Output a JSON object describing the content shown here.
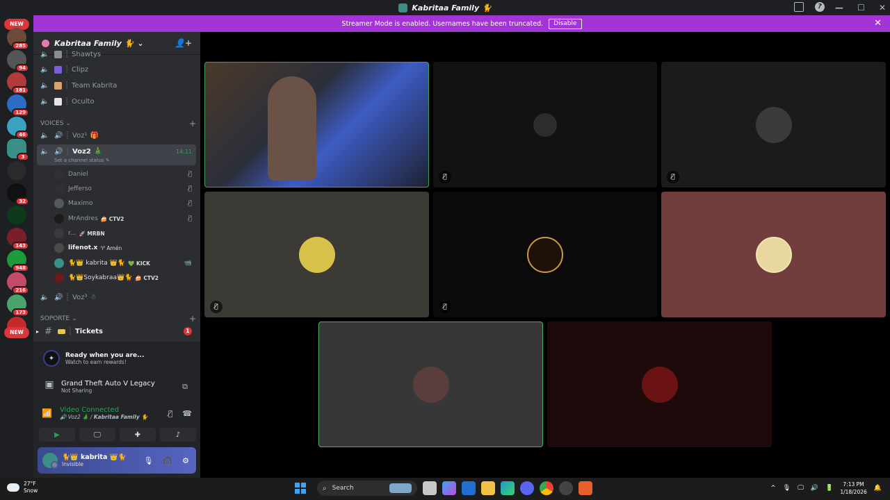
{
  "window": {
    "title": "Kabritaa Family 🐈",
    "help": "?",
    "minimize": "—",
    "maximize": "☐",
    "close": "✕"
  },
  "banner": {
    "text": "Streamer Mode is enabled. Usernames have been truncated.",
    "button": "Disable",
    "close": "✕"
  },
  "server_rail": {
    "badges": [
      "285",
      "94",
      "181",
      "129",
      "46",
      "3",
      "32",
      "143",
      "948",
      "216",
      "173"
    ],
    "new_label": "NEW"
  },
  "guild": {
    "name": "Kabritaa Family 🐈",
    "chevron": "⌄",
    "invite": "👤+"
  },
  "channels": [
    {
      "name": "Shawtys",
      "sep": "┊",
      "emoji_color": "#8a8d93"
    },
    {
      "name": "Clipz",
      "sep": "┊",
      "emoji_color": "#7b5fd6"
    },
    {
      "name": "Team Kabrita",
      "sep": "┊",
      "emoji_color": "#d9a26a"
    },
    {
      "name": "Oculto",
      "sep": "┊",
      "emoji_color": "#e6e6e6"
    }
  ],
  "voices_category": {
    "label": "VOICES",
    "chevron": "⌄",
    "plus": "+"
  },
  "voice_channels": {
    "voz1": {
      "name": "Voz¹",
      "emoji": "🎁"
    },
    "voz2": {
      "name": "Voz2",
      "emoji": "🎄",
      "timer": "14:11",
      "status": "Set a channel status ✎"
    },
    "voz3": {
      "name": "Voz³",
      "emoji": "☃"
    }
  },
  "members": [
    {
      "name": "Daniel",
      "tag": "",
      "mute": "🎙̸",
      "color": "#2f3136"
    },
    {
      "name": "Jefferso",
      "tag": "",
      "mute": "🎙̸",
      "color": "#2f3136"
    },
    {
      "name": "Maximo",
      "tag": "",
      "mute": "🎙̸",
      "color": "#55595f"
    },
    {
      "name": "MrAndres",
      "tag": "🍰 CTV2",
      "mute": "🎙̸",
      "color": "#1b1b1b"
    },
    {
      "name": "r...",
      "tag": "🚀 MRBN",
      "mute": "",
      "color": "#3a3a3a"
    },
    {
      "name": "lifenot.x",
      "tag": "♈ Amén",
      "mute": "",
      "color": "#4a4a4a"
    },
    {
      "name": "🐈👑 kabrita 👑🐈",
      "tag": "💚 KICK",
      "mute": "📹",
      "color": "#3a8f86"
    },
    {
      "name": "🐈👑Soykabraa👑🐈",
      "tag": "🍰 CTV2",
      "mute": "",
      "color": "#6b1a1a"
    }
  ],
  "soporte_category": {
    "label": "SOPORTE",
    "chevron": "⌄",
    "plus": "+"
  },
  "tickets": {
    "name": "Tickets",
    "badge": "1",
    "arrow": "▸",
    "hash": "#"
  },
  "rewards": {
    "title": "Ready when you are...",
    "subtitle": "Watch to earn rewards!"
  },
  "game": {
    "title": "Grand Theft Auto V Legacy",
    "subtitle": "Not Sharing",
    "share_icon": "⧉"
  },
  "voice_conn": {
    "status": "Video Connected",
    "location_prefix": "🔊 Voz2 🎄 / ",
    "location_server": "Kabritaa Family 🐈",
    "noise": "〰̸",
    "disconnect": "☎"
  },
  "voice_buttons": {
    "camera": "▶",
    "screen": "🖵",
    "activity": "✚",
    "soundboard": "♪"
  },
  "user": {
    "name": "🐈👑 kabrita 👑🐈",
    "status": "Invisible",
    "mic": "🎙",
    "headset": "🎧",
    "settings": "⚙",
    "chevron": "⌄"
  },
  "tiles": [
    {
      "id": "cam",
      "color": "#3a3f44",
      "border": "#43a15c",
      "muted": false
    },
    {
      "id": "t2",
      "color": "#121212",
      "border": "",
      "muted": true,
      "avatar": "#2c2c2c"
    },
    {
      "id": "t3",
      "color": "#1b1b1b",
      "border": "",
      "muted": true,
      "avatar": "#3b3b3b"
    },
    {
      "id": "t4",
      "color": "#3b3a35",
      "border": "",
      "muted": true,
      "avatar": "#d8c14a"
    },
    {
      "id": "t5",
      "color": "#0b0b0b",
      "border": "",
      "muted": true,
      "avatar": "#1e1208"
    },
    {
      "id": "t6",
      "color": "#713d3d",
      "border": "",
      "muted": false,
      "avatar": "#e8d8a0"
    },
    {
      "id": "t7",
      "color": "#373737",
      "border": "#47b35c",
      "muted": false,
      "avatar": "#5a3d3d"
    },
    {
      "id": "t8",
      "color": "#1e0a0a",
      "border": "",
      "muted": false,
      "avatar": "#6b1212"
    }
  ],
  "tile_mute_icon": "🎙̸",
  "taskbar": {
    "temp": "27°F",
    "condition": "Snow",
    "search": "Search",
    "search_icon": "⌕",
    "time": "7:13 PM",
    "date": "1/18/2026",
    "tray_icons": [
      "^",
      "🎙",
      "🖵",
      "🔊",
      "🔋",
      "🔔"
    ]
  }
}
